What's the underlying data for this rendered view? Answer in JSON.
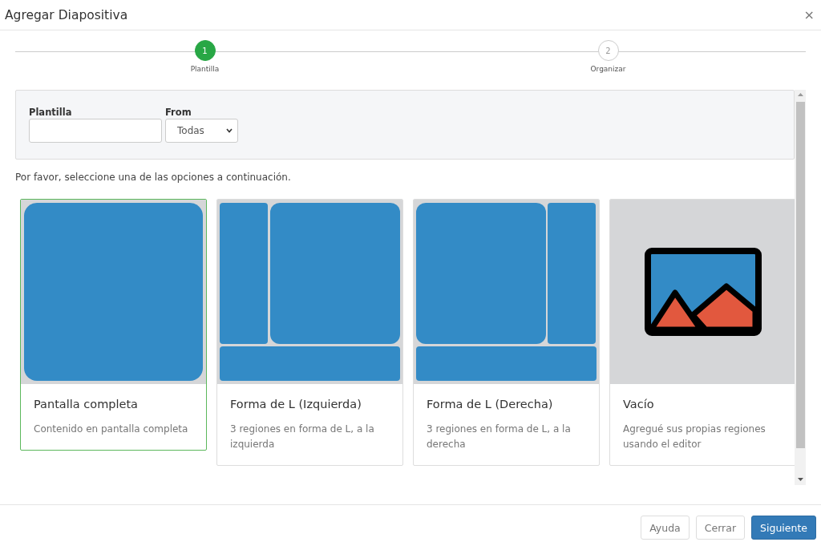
{
  "dialog": {
    "title": "Agregar Diapositiva",
    "close": "×"
  },
  "steps": [
    {
      "number": "1",
      "label": "Plantilla",
      "active": true
    },
    {
      "number": "2",
      "label": "Organizar",
      "active": false
    }
  ],
  "filters": {
    "template_label": "Plantilla",
    "from_label": "From",
    "from_value": "Todas"
  },
  "instruction": "Por favor, seleccione una de las opciones a continuación.",
  "cards": [
    {
      "kind": "full",
      "title": "Pantalla completa",
      "description": "Contenido en pantalla completa",
      "selected": true
    },
    {
      "kind": "l-left",
      "title": "Forma de L (Izquierda)",
      "description": "3 regiones en forma de L, a la izquierda",
      "selected": false
    },
    {
      "kind": "l-right",
      "title": "Forma de L (Derecha)",
      "description": "3 regiones en forma de L, a la derecha",
      "selected": false
    },
    {
      "kind": "empty",
      "title": "Vacío",
      "description": "Agregué sus propias regiones usando el editor",
      "selected": false
    }
  ],
  "buttons": [
    {
      "label": "Ayuda",
      "kind": "default"
    },
    {
      "label": "Cerrar",
      "kind": "default"
    },
    {
      "label": "Siguiente",
      "kind": "primary"
    }
  ]
}
